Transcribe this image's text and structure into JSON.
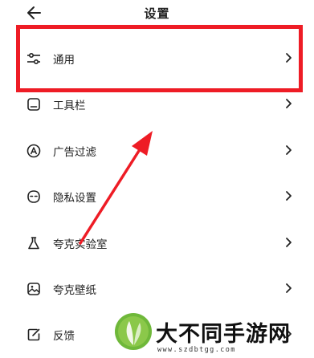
{
  "header": {
    "title": "设置",
    "back_icon": "arrow-left-icon"
  },
  "items": [
    {
      "label": "通用",
      "icon": "sliders-icon"
    },
    {
      "label": "工具栏",
      "icon": "toolbar-icon"
    },
    {
      "label": "广告过滤",
      "icon": "ad-filter-icon"
    },
    {
      "label": "隐私设置",
      "icon": "privacy-mask-icon"
    },
    {
      "label": "夸克实验室",
      "icon": "flask-icon"
    },
    {
      "label": "夸克壁纸",
      "icon": "wallpaper-icon"
    },
    {
      "label": "反馈",
      "icon": "feedback-edit-icon"
    }
  ],
  "chevron": "›",
  "annotation": {
    "highlight_color": "#ee1c25",
    "arrow_color": "#ee1c25"
  },
  "watermark": {
    "text": "大不同手游网",
    "url": "www.szdbtgg.com"
  }
}
